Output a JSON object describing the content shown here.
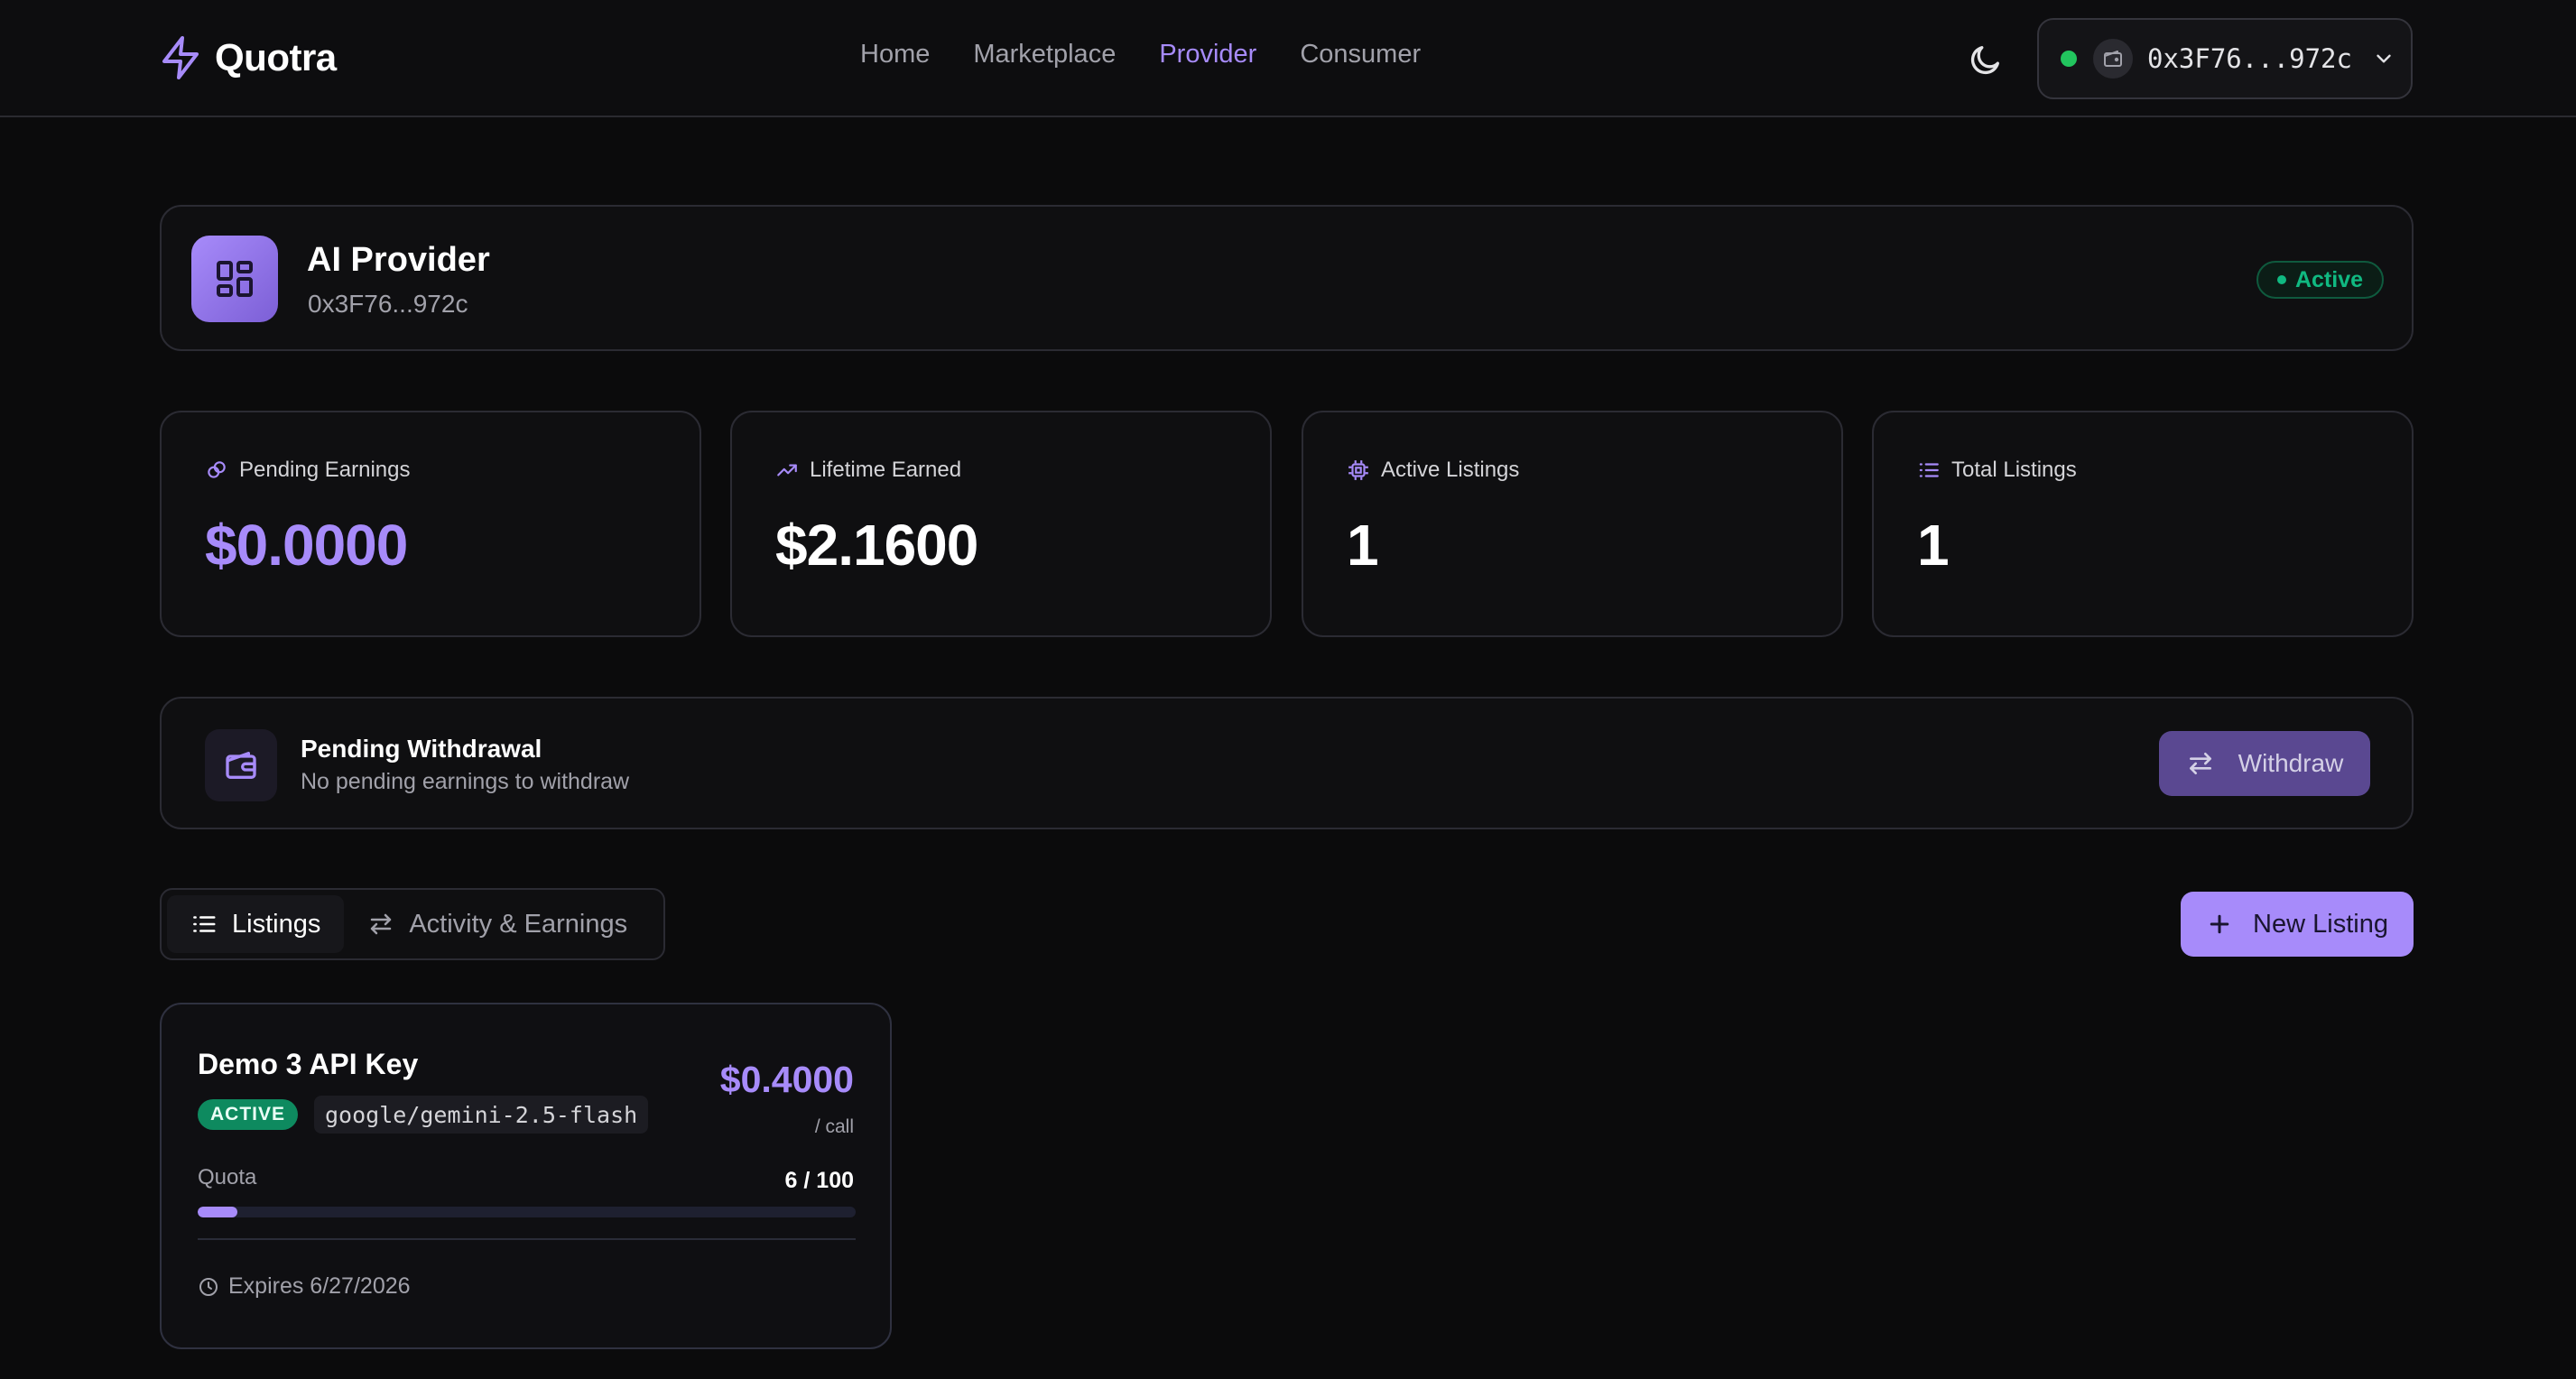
{
  "header": {
    "logo_text": "Quotra",
    "nav": [
      {
        "label": "Home",
        "active": false
      },
      {
        "label": "Marketplace",
        "active": false
      },
      {
        "label": "Provider",
        "active": true
      },
      {
        "label": "Consumer",
        "active": false
      }
    ],
    "wallet_address": "0x3F76...972c"
  },
  "provider": {
    "name": "AI Provider",
    "address": "0x3F76...972c",
    "status": "Active"
  },
  "stats": [
    {
      "label": "Pending Earnings",
      "value": "$0.0000",
      "icon": "coins-icon"
    },
    {
      "label": "Lifetime Earned",
      "value": "$2.1600",
      "icon": "trending-up-icon"
    },
    {
      "label": "Active Listings",
      "value": "1",
      "icon": "chip-icon"
    },
    {
      "label": "Total Listings",
      "value": "1",
      "icon": "list-icon"
    }
  ],
  "withdrawal": {
    "title": "Pending Withdrawal",
    "subtitle": "No pending earnings to withdraw",
    "button_label": "Withdraw"
  },
  "tabs": [
    {
      "label": "Listings",
      "active": true
    },
    {
      "label": "Activity & Earnings",
      "active": false
    }
  ],
  "new_listing_label": "New Listing",
  "listings": [
    {
      "name": "Demo 3 API Key",
      "status": "ACTIVE",
      "model": "google/gemini-2.5-flash",
      "price": "$0.4000",
      "unit": "/ call",
      "quota_label": "Quota",
      "quota_text": "6 / 100",
      "quota_used": 6,
      "quota_total": 100,
      "expires": "Expires 6/27/2026"
    }
  ],
  "colors": {
    "accent": "#a78bfa",
    "success": "#10b981",
    "wallet_connected": "#22c55e",
    "background": "#0b0b0c"
  }
}
